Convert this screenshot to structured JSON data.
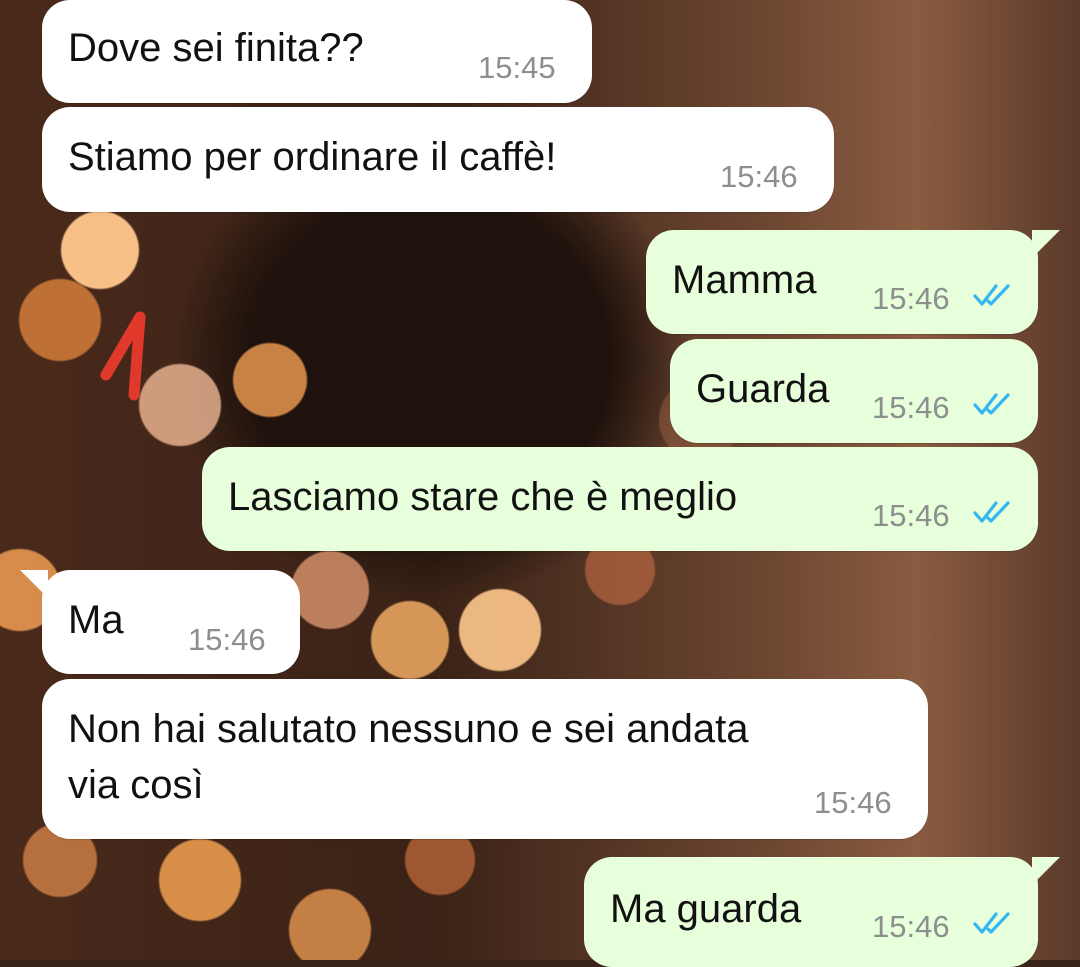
{
  "colors": {
    "incoming_bubble": "#ffffff",
    "outgoing_bubble": "#e7ffdb",
    "read_ticks": "#34b7f1",
    "annotation_mark": "#e0392b"
  },
  "annotation": {
    "icon": "red-stroke-mark"
  },
  "messages": [
    {
      "direction": "incoming",
      "text": "Dove sei finita??",
      "time": "15:45"
    },
    {
      "direction": "incoming",
      "text": "Stiamo per ordinare il caffè!",
      "time": "15:46"
    },
    {
      "direction": "outgoing",
      "text": "Mamma",
      "time": "15:46",
      "status_icon": "double-check-read-icon"
    },
    {
      "direction": "outgoing",
      "text": "Guarda",
      "time": "15:46",
      "status_icon": "double-check-read-icon"
    },
    {
      "direction": "outgoing",
      "text": "Lasciamo stare che è meglio",
      "time": "15:46",
      "status_icon": "double-check-read-icon"
    },
    {
      "direction": "incoming",
      "text": "Ma",
      "time": "15:46"
    },
    {
      "direction": "incoming",
      "text": "Non hai salutato nessuno e sei andata\nvia così",
      "time": "15:46"
    },
    {
      "direction": "outgoing",
      "text": "Ma guarda",
      "time": "15:46",
      "status_icon": "double-check-read-icon"
    }
  ]
}
